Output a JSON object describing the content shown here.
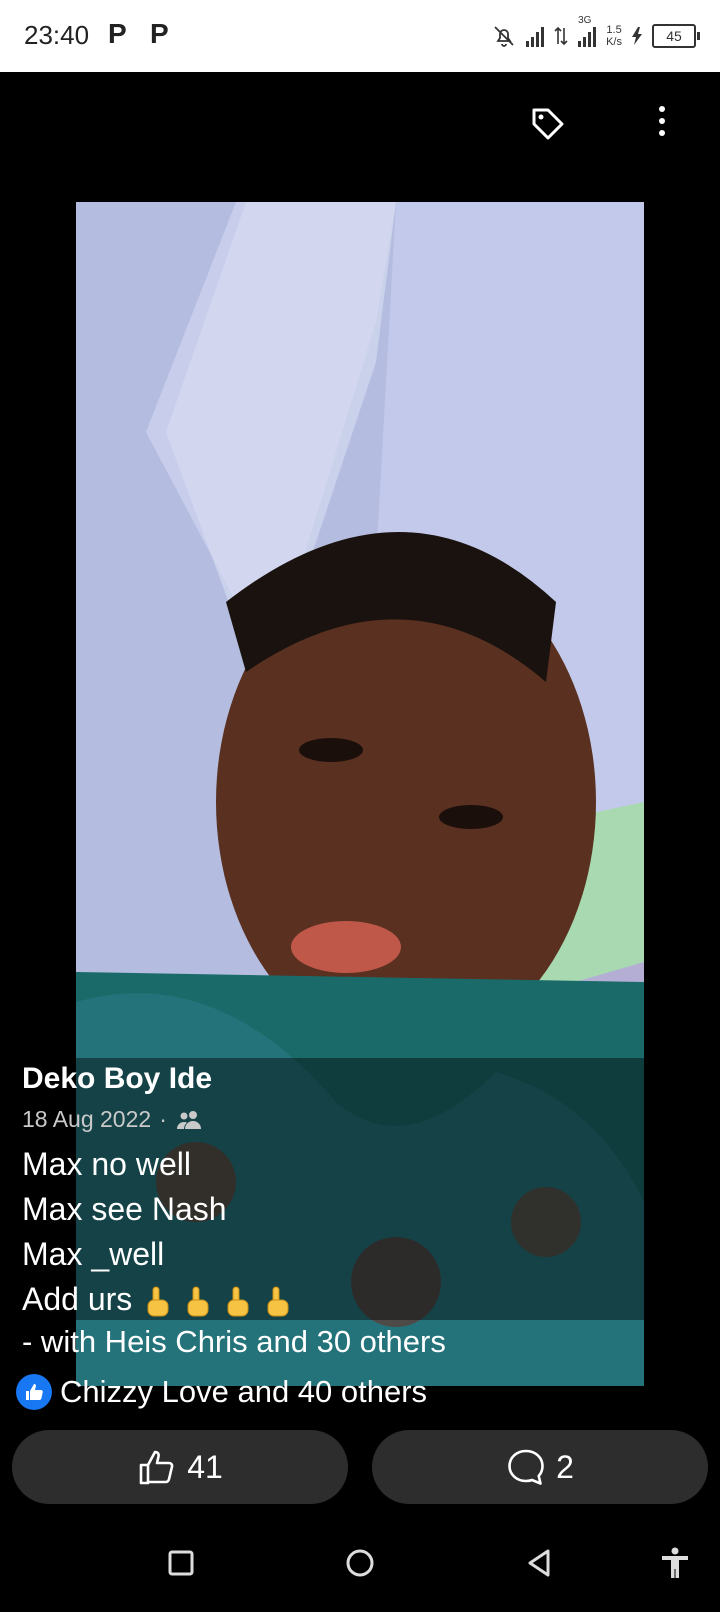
{
  "status_bar": {
    "time": "23:40",
    "notif_icons": [
      "P",
      "P"
    ],
    "network": "3G",
    "speed_value": "1.5",
    "speed_unit": "K/s",
    "battery": "45"
  },
  "post": {
    "author": "Deko Boy Ide",
    "date": "18 Aug 2022",
    "separator": "·",
    "audience_icon": "friends-icon",
    "lines": [
      "Max no well",
      "Max see Nash",
      "Max _well",
      "Add urs"
    ],
    "emoji_count": 4,
    "tagged": "- with Heis Chris and 30 others",
    "reactions_text": "Chizzy Love and 40 others"
  },
  "actions": {
    "like_count": "41",
    "comment_count": "2"
  },
  "top_icons": [
    "tag-icon",
    "more-options-icon"
  ],
  "nav_icons": [
    "recents-icon",
    "home-icon",
    "back-icon",
    "accessibility-icon"
  ],
  "colors": {
    "like_blue": "#1877f2",
    "button_bg": "#2d2d2d"
  }
}
